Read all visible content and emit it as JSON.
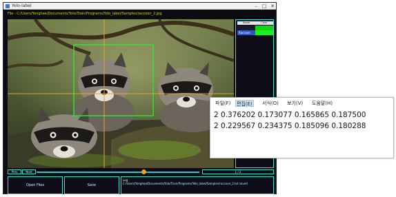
{
  "window": {
    "title": "Yolo-label",
    "filepath": "File : C:/Users/Yonghae/Documents/Yolo/Train/Programs/Yolo_label/Samples/raccoon_2.jpg",
    "minimize": "–",
    "maximize": "□",
    "close": "✕"
  },
  "classes": {
    "header_name": "Name",
    "header_color": "Color",
    "items": [
      {
        "name": "",
        "color": "#14d414"
      },
      {
        "name": "Raccoon",
        "color": "#1ef01e"
      }
    ]
  },
  "controls": {
    "prev_label": "Prev",
    "next_label": "Next",
    "frame_label": "1 / 2",
    "slider_fraction": 0.66,
    "open_files_label": "Open Files",
    "save_label": "Save",
    "log_label": "Log",
    "log_text": "C:/Users/Yonghae/Documents/Yolo/Train/Programs/Yolo_label/Samples/raccoon_2.txt saved"
  },
  "notepad": {
    "menu": [
      {
        "label": "파일(F)",
        "active": false
      },
      {
        "label": "편집(E)",
        "active": true
      },
      {
        "label": "서식(O)",
        "active": false
      },
      {
        "label": "보기(V)",
        "active": false
      },
      {
        "label": "도움말(H)",
        "active": false
      }
    ],
    "lines": [
      "2 0.376202 0.173077 0.165865 0.187500",
      "2 0.229567 0.234375 0.185096 0.180288"
    ]
  },
  "colors": {
    "accent": "#2ee6d8",
    "bbox": "#35e035",
    "crosshair": "#f0a020",
    "slider_thumb": "#f3a21b",
    "path_text": "#d6d600"
  }
}
